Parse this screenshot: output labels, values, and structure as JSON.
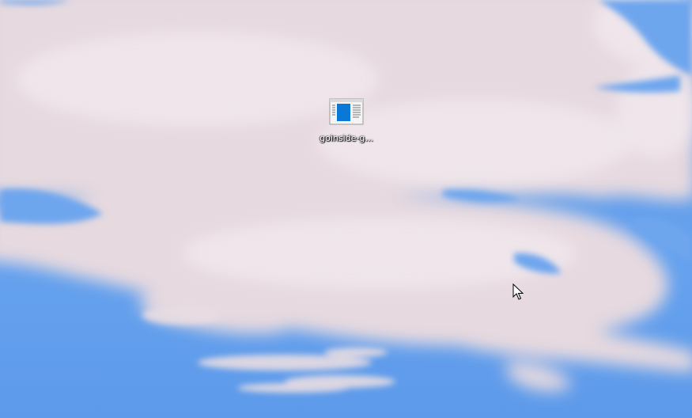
{
  "desktop": {
    "wallpaper_icon": "cloudy-sky-wallpaper",
    "sky_color": "#5f9ce8",
    "cloud_color": "#e7dbe1"
  },
  "icons": [
    {
      "label": "goinside-g...",
      "icon": "html-document-icon",
      "accent_color": "#0078d7"
    }
  ],
  "cursor": {
    "icon": "mouse-pointer-icon"
  }
}
